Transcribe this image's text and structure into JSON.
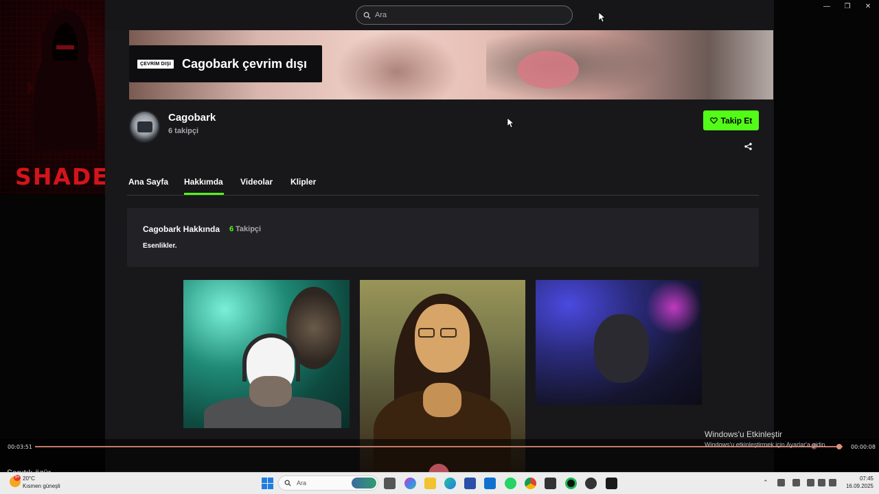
{
  "search": {
    "placeholder": "Ara"
  },
  "overlay": {
    "brand_text": "SHADE"
  },
  "banner": {
    "offline_badge": "ÇEVRİM DIŞI",
    "offline_text": "Cagobark çevrim dışı"
  },
  "channel": {
    "name": "Cagobark",
    "followers": "6 takipçi",
    "follow_label": "Takip Et"
  },
  "tabs": [
    {
      "label": "Ana Sayfa",
      "active": false
    },
    {
      "label": "Hakkımda",
      "active": true
    },
    {
      "label": "Videolar",
      "active": false
    },
    {
      "label": "Klipler",
      "active": false
    }
  ],
  "about": {
    "title": "Cagobark Hakkında",
    "follower_count": "6",
    "follower_label": "Takipçi",
    "description": "Esenlikler."
  },
  "player": {
    "time_elapsed": "00:03:51",
    "time_remaining": "00:00:08",
    "progress": 0.996,
    "caption": "Sapıtık özür"
  },
  "windows_activation": {
    "title": "Windows'u Etkinleştir",
    "subtitle": "Windows'u etkinleştirmek için Ayarlar'a gidin."
  },
  "taskbar": {
    "weather_temp": "20°C",
    "weather_condition": "Kısmen güneşli",
    "weather_badge": "9+",
    "search_label": "Ara",
    "time": "07:45",
    "date": "16.09.2025"
  },
  "colors": {
    "accent": "#53fc18",
    "background": "#18181a",
    "card": "#222226",
    "brand_red": "#d4141c"
  }
}
